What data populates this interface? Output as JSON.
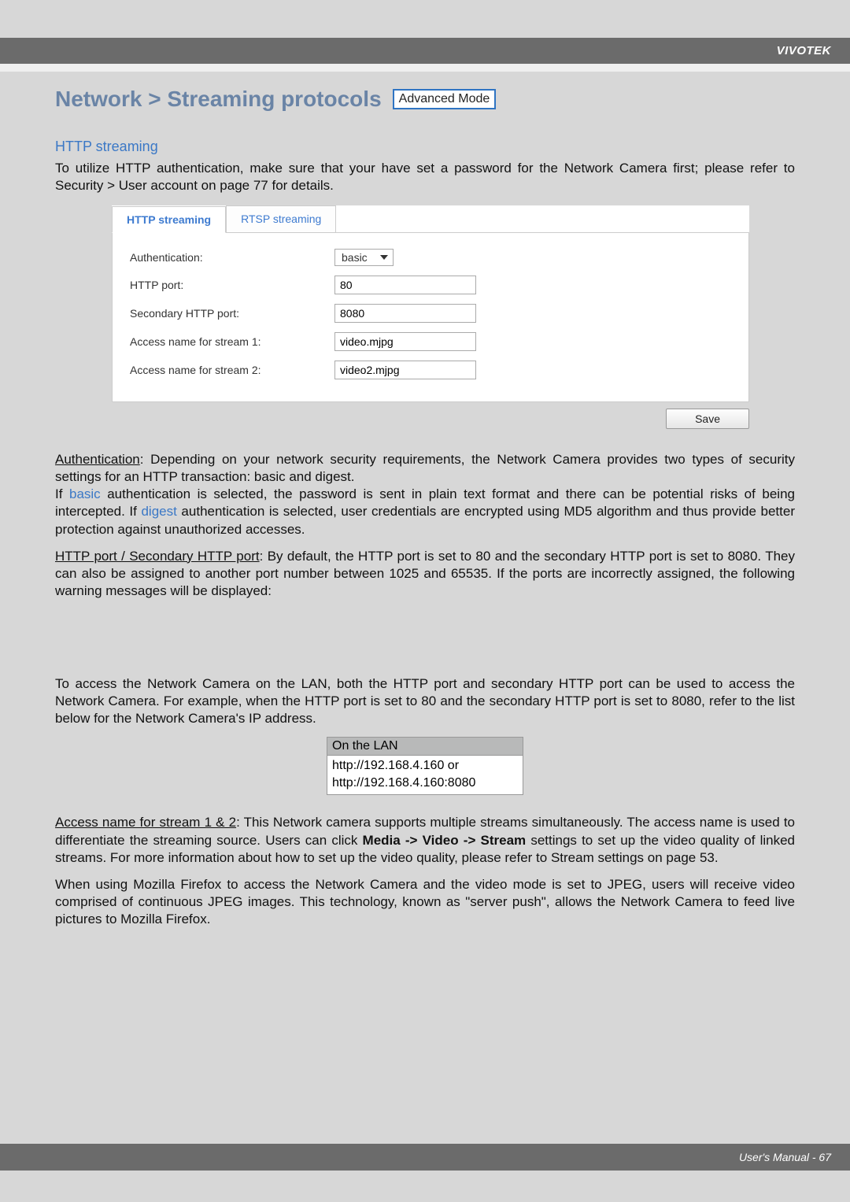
{
  "brand": "VIVOTEK",
  "page": {
    "title": "Network > Streaming protocols",
    "badge": "Advanced Mode"
  },
  "httpSection": {
    "heading": "HTTP streaming",
    "intro": "To utilize HTTP authentication, make sure that your have set a password for the Network Camera first; please refer to Security > User account on page 77 for details."
  },
  "ui": {
    "tabs": {
      "http": "HTTP streaming",
      "rtsp": "RTSP streaming"
    },
    "labels": {
      "authentication": "Authentication:",
      "httpPort": "HTTP port:",
      "secondaryHttpPort": "Secondary HTTP port:",
      "access1": "Access name for stream 1:",
      "access2": "Access name for stream 2:"
    },
    "values": {
      "authentication": "basic",
      "httpPort": "80",
      "secondaryHttpPort": "8080",
      "access1": "video.mjpg",
      "access2": "video2.mjpg"
    },
    "saveLabel": "Save"
  },
  "para": {
    "authHead": "Authentication",
    "authBody1": ": Depending on your network security requirements, the Network Camera provides two types of security settings for an HTTP transaction: basic and digest.",
    "authBodyIf": "If ",
    "authBodyBasic": "basic",
    "authBody2": " authentication is selected, the password is sent in plain text format and there can be potential risks of being intercepted. If ",
    "authBodyDigest": "digest",
    "authBody3": " authentication is selected, user credentials are encrypted using MD5 algorithm and thus provide better protection against unauthorized accesses.",
    "portHead": "HTTP port / Secondary HTTP port",
    "portBody": ": By default, the HTTP port is set to 80 and the secondary HTTP port is set to 8080. They can also be assigned to another port number between 1025 and 65535. If the ports are incorrectly assigned, the following warning messages will be displayed:",
    "lanIntro": "To access the Network Camera on the LAN, both the HTTP port and secondary HTTP port can be used to access the Network Camera. For example, when the HTTP port is set to 80 and the secondary HTTP port is set to 8080, refer to the list below for the Network Camera's IP address.",
    "lanHead": "On the LAN",
    "lanLine1": "http://192.168.4.160  or",
    "lanLine2": "http://192.168.4.160:8080",
    "accessHead": "Access name for stream 1 & 2",
    "accessBody1": ": This Network camera supports multiple streams simultaneously. The access name is used to differentiate the streaming source. Users can click ",
    "accessBodyBold": "Media -> Video -> Stream",
    "accessBody2": " settings to set up the video quality of linked streams. For more information about how to set up the video quality, please refer to Stream settings on page 53.",
    "firefox": "When using Mozilla Firefox  to access the Network Camera and the video mode is set to JPEG, users will receive video comprised of continuous JPEG images. This technology, known as \"server push\", allows the Network Camera to feed live pictures to Mozilla Firefox."
  },
  "footer": "User's Manual - 67"
}
